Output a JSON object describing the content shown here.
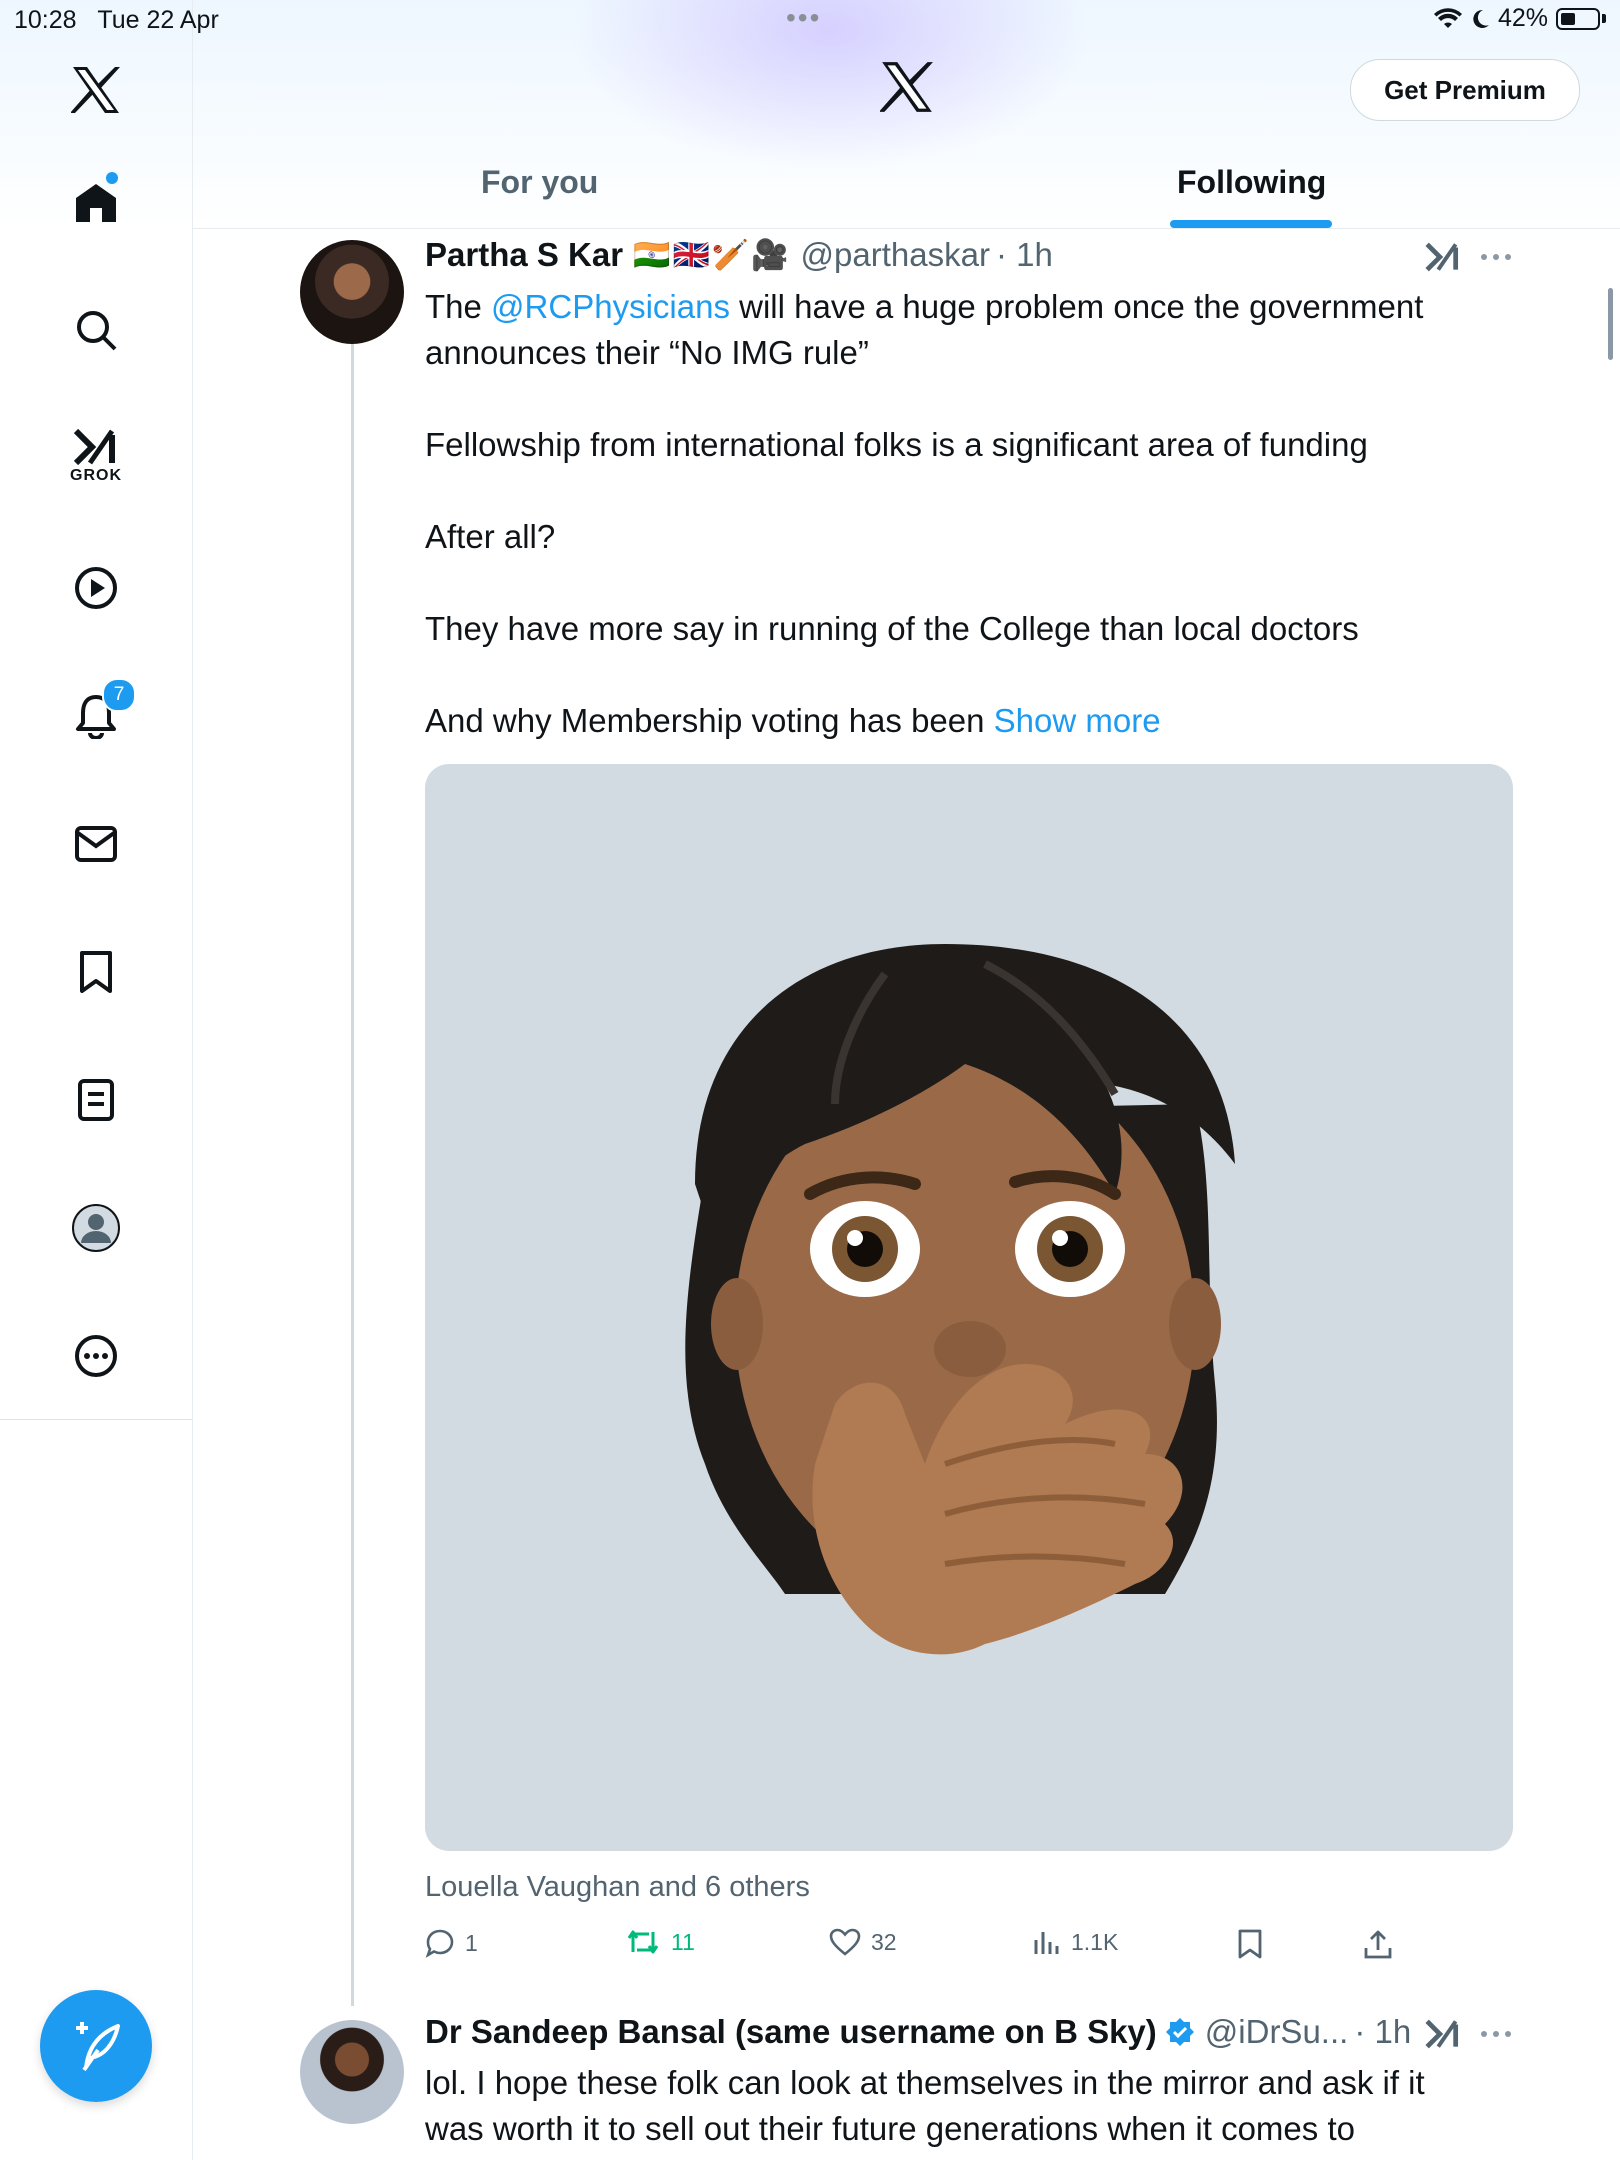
{
  "status_bar": {
    "time": "10:28",
    "date": "Tue 22 Apr",
    "battery": "42%",
    "battery_level": 0.42,
    "icons": [
      "wifi-icon",
      "moon-icon",
      "battery-icon"
    ]
  },
  "sidebar": {
    "items": [
      {
        "name": "x-logo",
        "icon": "x-logo-icon"
      },
      {
        "name": "home",
        "icon": "home-icon"
      },
      {
        "name": "search",
        "icon": "search-icon"
      },
      {
        "name": "grok",
        "icon": "grok-icon",
        "label": "GROK"
      },
      {
        "name": "video",
        "icon": "play-icon"
      },
      {
        "name": "notifications",
        "icon": "bell-icon",
        "badge": "7"
      },
      {
        "name": "messages",
        "icon": "mail-icon"
      },
      {
        "name": "bookmarks",
        "icon": "bookmark-icon"
      },
      {
        "name": "lists",
        "icon": "list-icon"
      },
      {
        "name": "profile",
        "icon": "profile-icon"
      },
      {
        "name": "more",
        "icon": "more-icon"
      }
    ],
    "compose_icon": "compose-icon"
  },
  "header": {
    "logo": "x-logo-icon",
    "premium_button": "Get Premium"
  },
  "tabs": [
    {
      "label": "For you",
      "active": false
    },
    {
      "label": "Following",
      "active": true
    }
  ],
  "posts": [
    {
      "name": "Partha S Kar",
      "emojis": "🇮🇳🇬🇧🏏🎥",
      "handle": "@parthaskar",
      "time": "· 1h",
      "text_prefix": "The ",
      "mention": "@RCPhysicians",
      "text_line1_rest": " will have a huge problem once the government announces their “No IMG rule”",
      "paragraphs": [
        "Fellowship from international folks is a significant area of funding",
        "After all?",
        "They have more say in running of the College than local doctors"
      ],
      "last_line": "And why Membership voting has been ",
      "show_more": "Show more",
      "liked_by": "Louella Vaughan and 6 others",
      "actions": {
        "replies": "1",
        "reposts": "11",
        "likes": "32",
        "views": "1.1K"
      }
    },
    {
      "name": "Dr Sandeep Bansal (same username on B Sky)",
      "handle": "@iDrSu...",
      "time": "· 1h",
      "text": "lol. I hope these folk can look at themselves in the mirror and ask if it was worth it to sell out their future generations when it comes to"
    }
  ],
  "colors": {
    "accent": "#1d9bf0",
    "repost_green": "#00ba7c",
    "secondary_text": "#536471",
    "media_bg": "#d2dbe1"
  }
}
